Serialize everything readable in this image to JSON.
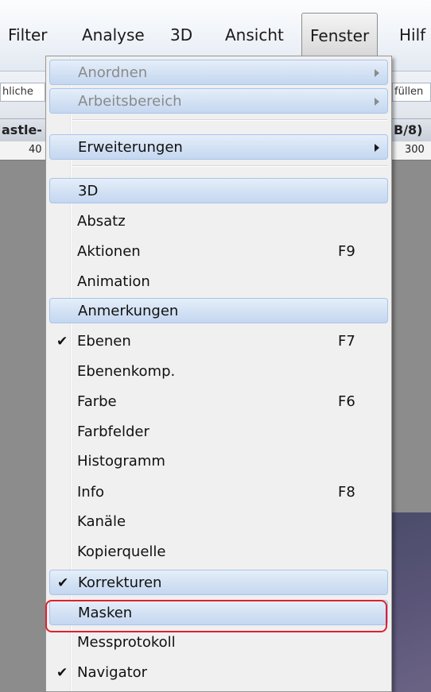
{
  "menubar": {
    "items": [
      {
        "label": "Filter"
      },
      {
        "label": "Analyse"
      },
      {
        "label": "3D"
      },
      {
        "label": "Ansicht"
      },
      {
        "label": "Fenster"
      },
      {
        "label": "Hilf"
      }
    ]
  },
  "background": {
    "left_field": "hliche",
    "right_field": "füllen",
    "doc_tab_left": "astle-",
    "doc_tab_right": "B/8)",
    "ruler_left": "40",
    "ruler_right": "300"
  },
  "menu": {
    "items": [
      {
        "label": "Anordnen",
        "shortcut": "",
        "checked": false
      },
      {
        "label": "Arbeitsbereich",
        "shortcut": "",
        "checked": false
      },
      {
        "label": "Erweiterungen",
        "shortcut": "",
        "checked": false
      },
      {
        "label": "3D",
        "shortcut": "",
        "checked": false
      },
      {
        "label": "Absatz",
        "shortcut": "",
        "checked": false
      },
      {
        "label": "Aktionen",
        "shortcut": "F9",
        "checked": false
      },
      {
        "label": "Animation",
        "shortcut": "",
        "checked": false
      },
      {
        "label": "Anmerkungen",
        "shortcut": "",
        "checked": false
      },
      {
        "label": "Ebenen",
        "shortcut": "F7",
        "checked": true
      },
      {
        "label": "Ebenenkomp.",
        "shortcut": "",
        "checked": false
      },
      {
        "label": "Farbe",
        "shortcut": "F6",
        "checked": false
      },
      {
        "label": "Farbfelder",
        "shortcut": "",
        "checked": false
      },
      {
        "label": "Histogramm",
        "shortcut": "",
        "checked": false
      },
      {
        "label": "Info",
        "shortcut": "F8",
        "checked": false
      },
      {
        "label": "Kanäle",
        "shortcut": "",
        "checked": false
      },
      {
        "label": "Kopierquelle",
        "shortcut": "",
        "checked": false
      },
      {
        "label": "Korrekturen",
        "shortcut": "",
        "checked": true
      },
      {
        "label": "Masken",
        "shortcut": "",
        "checked": false
      },
      {
        "label": "Messprotokoll",
        "shortcut": "",
        "checked": false
      },
      {
        "label": "Navigator",
        "shortcut": "",
        "checked": true
      }
    ],
    "check_glyph": "✔"
  },
  "colors": {
    "highlight": "#d4e2f4",
    "annotation": "#e0202e"
  }
}
